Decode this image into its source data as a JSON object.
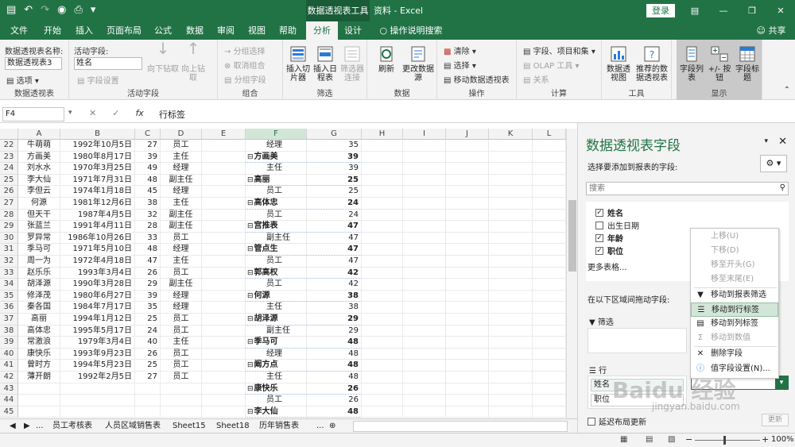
{
  "titlebar": {
    "context_tab": "数据透视表工具",
    "doc_title": "资料  -  Excel",
    "login": "登录"
  },
  "tabs": [
    "文件",
    "开始",
    "插入",
    "页面布局",
    "公式",
    "数据",
    "审阅",
    "视图",
    "帮助",
    "分析",
    "设计",
    "操作说明搜索"
  ],
  "share": "共享",
  "ribbon": {
    "pt_name_label": "数据透视表名称:",
    "pt_name_value": "数据透视表3",
    "options": "选项",
    "active_field_label": "活动字段:",
    "active_field_value": "姓名",
    "field_settings": "字段设置",
    "drill_down": "向下钻取",
    "drill_up": "向上钻取",
    "group_sel": "分组选择",
    "ungroup": "取消组合",
    "group_field": "分组字段",
    "slicer": "插入切片器",
    "timeline": "插入日程表",
    "filter_conn": "筛选器连接",
    "refresh": "刷新",
    "change_source": "更改数据源",
    "clear": "清除",
    "select": "选择",
    "move_pt": "移动数据透视表",
    "fields_items": "字段、项目和集",
    "olap": "OLAP 工具",
    "relations": "关系",
    "pivotchart": "数据透视图",
    "recommended": "推荐的数据透视表",
    "field_list": "字段列表",
    "buttons": "+/- 按钮",
    "headers": "字段标题",
    "groups": [
      "数据透视表",
      "活动字段",
      "组合",
      "筛选",
      "数据",
      "操作",
      "计算",
      "工具",
      "显示"
    ]
  },
  "formula": {
    "name_box": "F4",
    "value": "行标签"
  },
  "columns": [
    "A",
    "B",
    "C",
    "D",
    "E",
    "F",
    "G",
    "H",
    "I",
    "J",
    "K",
    "L"
  ],
  "rows": [
    {
      "n": "22",
      "a": "牛萌萌",
      "b": "1992年10月5日",
      "c": "27",
      "d": "员工",
      "f": "经理",
      "fi": 2,
      "g": "35",
      "gb": false
    },
    {
      "n": "23",
      "a": "方画美",
      "b": "1980年8月17日",
      "c": "39",
      "d": "主任",
      "f": "方画美",
      "fi": 0,
      "g": "39",
      "gb": true
    },
    {
      "n": "24",
      "a": "刘水水",
      "b": "1970年3月25日",
      "c": "49",
      "d": "经理",
      "f": "主任",
      "fi": 2,
      "g": "39",
      "gb": false
    },
    {
      "n": "25",
      "a": "李大仙",
      "b": "1971年7月31日",
      "c": "48",
      "d": "副主任",
      "f": "高丽",
      "fi": 0,
      "g": "25",
      "gb": true
    },
    {
      "n": "26",
      "a": "李但云",
      "b": "1974年1月18日",
      "c": "45",
      "d": "经理",
      "f": "员工",
      "fi": 2,
      "g": "25",
      "gb": false
    },
    {
      "n": "27",
      "a": "何源",
      "b": "1981年12月6日",
      "c": "38",
      "d": "主任",
      "f": "高体忠",
      "fi": 0,
      "g": "24",
      "gb": true
    },
    {
      "n": "28",
      "a": "但天干",
      "b": "1987年4月5日",
      "c": "32",
      "d": "副主任",
      "f": "员工",
      "fi": 2,
      "g": "24",
      "gb": false
    },
    {
      "n": "29",
      "a": "张蓝兰",
      "b": "1991年4月11日",
      "c": "28",
      "d": "副主任",
      "f": "宫推表",
      "fi": 0,
      "g": "47",
      "gb": true
    },
    {
      "n": "30",
      "a": "罗异常",
      "b": "1986年10月26日",
      "c": "33",
      "d": "员工",
      "f": "副主任",
      "fi": 2,
      "g": "47",
      "gb": false
    },
    {
      "n": "31",
      "a": "季马可",
      "b": "1971年5月10日",
      "c": "48",
      "d": "经理",
      "f": "管点生",
      "fi": 0,
      "g": "47",
      "gb": true
    },
    {
      "n": "32",
      "a": "周一为",
      "b": "1972年4月18日",
      "c": "47",
      "d": "主任",
      "f": "员工",
      "fi": 2,
      "g": "47",
      "gb": false
    },
    {
      "n": "33",
      "a": "赵乐乐",
      "b": "1993年3月4日",
      "c": "26",
      "d": "员工",
      "f": "郭高权",
      "fi": 0,
      "g": "42",
      "gb": true
    },
    {
      "n": "34",
      "a": "胡泽源",
      "b": "1990年3月28日",
      "c": "29",
      "d": "副主任",
      "f": "员工",
      "fi": 2,
      "g": "42",
      "gb": false
    },
    {
      "n": "35",
      "a": "修泽茂",
      "b": "1980年6月27日",
      "c": "39",
      "d": "经理",
      "f": "何源",
      "fi": 0,
      "g": "38",
      "gb": true
    },
    {
      "n": "36",
      "a": "秦各国",
      "b": "1984年7月17日",
      "c": "35",
      "d": "经理",
      "f": "主任",
      "fi": 2,
      "g": "38",
      "gb": false
    },
    {
      "n": "37",
      "a": "高丽",
      "b": "1994年1月12日",
      "c": "25",
      "d": "员工",
      "f": "胡泽源",
      "fi": 0,
      "g": "29",
      "gb": true
    },
    {
      "n": "38",
      "a": "高体忠",
      "b": "1995年5月17日",
      "c": "24",
      "d": "员工",
      "f": "副主任",
      "fi": 2,
      "g": "29",
      "gb": false
    },
    {
      "n": "39",
      "a": "常激浪",
      "b": "1979年3月4日",
      "c": "40",
      "d": "主任",
      "f": "季马可",
      "fi": 0,
      "g": "48",
      "gb": true
    },
    {
      "n": "40",
      "a": "康快乐",
      "b": "1993年9月23日",
      "c": "26",
      "d": "员工",
      "f": "经理",
      "fi": 2,
      "g": "48",
      "gb": false
    },
    {
      "n": "41",
      "a": "曾时方",
      "b": "1994年5月23日",
      "c": "25",
      "d": "员工",
      "f": "阚方点",
      "fi": 0,
      "g": "48",
      "gb": true
    },
    {
      "n": "42",
      "a": "薄开朗",
      "b": "1992年2月5日",
      "c": "27",
      "d": "员工",
      "f": "主任",
      "fi": 2,
      "g": "48",
      "gb": false
    },
    {
      "n": "43",
      "a": "",
      "b": "",
      "c": "",
      "d": "",
      "f": "康快乐",
      "fi": 0,
      "g": "26",
      "gb": true
    },
    {
      "n": "44",
      "a": "",
      "b": "",
      "c": "",
      "d": "",
      "f": "员工",
      "fi": 2,
      "g": "26",
      "gb": false
    },
    {
      "n": "45",
      "a": "",
      "b": "",
      "c": "",
      "d": "",
      "f": "李大仙",
      "fi": 0,
      "g": "48",
      "gb": true
    }
  ],
  "sheet_tabs": [
    "员工考核表",
    "人员区域销售表",
    "Sheet15",
    "Sheet18",
    "历年销售表",
    "..."
  ],
  "pane": {
    "title": "数据透视表字段",
    "choose": "选择要添加到报表的字段:",
    "search_placeholder": "搜索",
    "fields": [
      {
        "name": "姓名",
        "checked": true,
        "bold": true
      },
      {
        "name": "出生日期",
        "checked": false,
        "bold": false
      },
      {
        "name": "年龄",
        "checked": true,
        "bold": true
      },
      {
        "name": "职位",
        "checked": true,
        "bold": true
      }
    ],
    "more_tables": "更多表格...",
    "drag_label": "在以下区域间拖动字段:",
    "filter_area": "筛选",
    "row_area": "行",
    "row_item1": "姓名",
    "row_item2": "职位",
    "defer": "延迟布局更新",
    "update": "更新"
  },
  "context_menu": [
    "上移(U)",
    "下移(D)",
    "移至开头(G)",
    "移至末尾(E)",
    "移动到报表筛选",
    "移动到行标签",
    "移动到列标签",
    "移动到数值",
    "删除字段",
    "值字段设置(N)..."
  ],
  "status": {
    "zoom": "100%"
  },
  "watermark": "Baidu 经验",
  "watermark_url": "jingyan.baidu.com"
}
